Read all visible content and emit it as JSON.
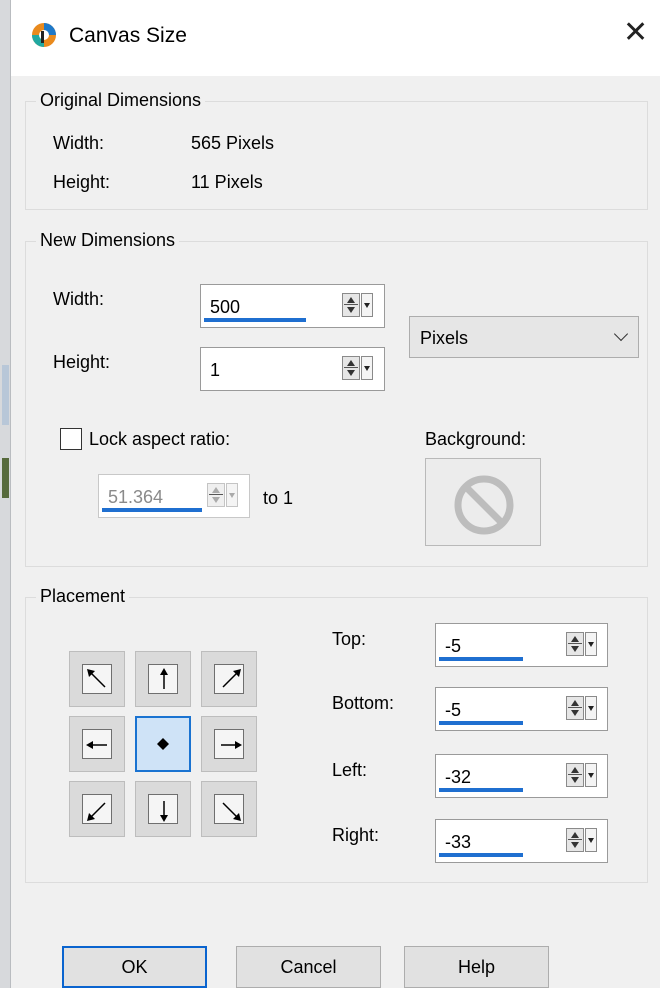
{
  "dialog": {
    "title": "Canvas Size",
    "close_glyph": "✕",
    "app_icon": "paint-shop-pro-icon"
  },
  "original": {
    "legend": "Original Dimensions",
    "width_label": "Width:",
    "width_value": "565 Pixels",
    "height_label": "Height:",
    "height_value": "11 Pixels"
  },
  "new_dims": {
    "legend": "New Dimensions",
    "width_label": "Width:",
    "width_value": "500",
    "height_label": "Height:",
    "height_value": "1",
    "units": "Pixels",
    "lock_label": "Lock aspect ratio:",
    "lock_checked": false,
    "ratio_value": "51.364",
    "ratio_suffix": "to 1",
    "background_label": "Background:"
  },
  "placement": {
    "legend": "Placement",
    "selected": "center",
    "top_label": "Top:",
    "top_value": "-5",
    "bottom_label": "Bottom:",
    "bottom_value": "-5",
    "left_label": "Left:",
    "left_value": "-32",
    "right_label": "Right:",
    "right_value": "-33"
  },
  "buttons": {
    "ok": "OK",
    "cancel": "Cancel",
    "help": "Help"
  },
  "colors": {
    "accent": "#1a73d1",
    "dialog_bg": "#f0f0f0"
  }
}
